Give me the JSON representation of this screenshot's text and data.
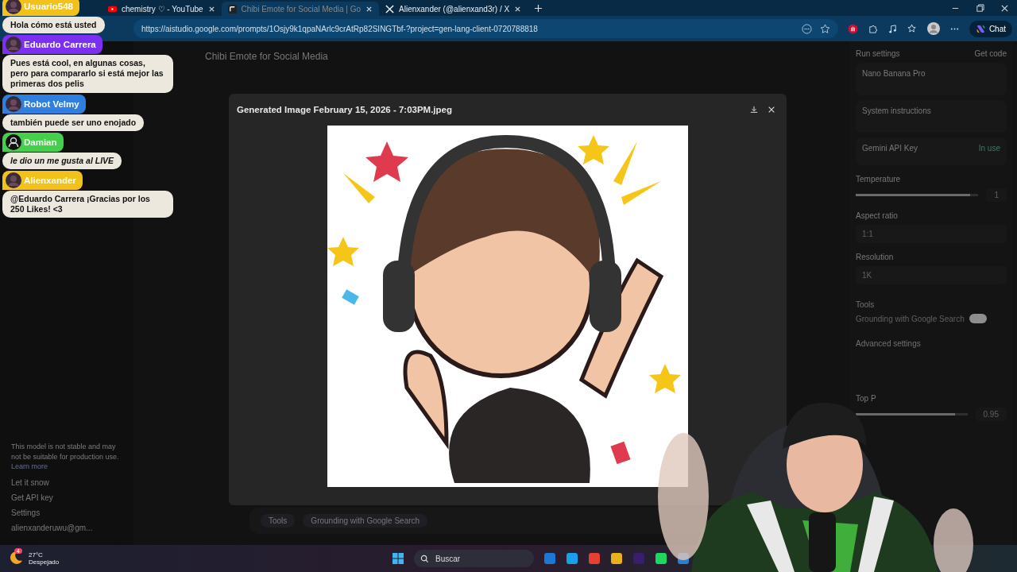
{
  "browser": {
    "tabs": [
      {
        "title": "chemistry ♡ - YouTube",
        "kind": "youtube",
        "selected": false
      },
      {
        "title": "Chibi Emote for Social Media | Go",
        "kind": "studio",
        "selected": true
      },
      {
        "title": "Alienxander (@alienxand3r) / X",
        "kind": "x",
        "selected": false
      }
    ],
    "url": "https://aistudio.google.com/prompts/1Osjy9k1qpaNArlc9crAtRp82SINGTbf-?project=gen-lang-client-0720788818",
    "chat_button": "Chat"
  },
  "app": {
    "title": "Chibi Emote for Social Media",
    "sidebar": {
      "notice": "This model is not stable and may not be suitable for production use.",
      "notice_link": "Learn more",
      "items": [
        "Let it snow",
        "Get API key",
        "Settings"
      ],
      "account": "alienxanderuwu@gm..."
    },
    "run_settings": {
      "title": "Run settings",
      "get_code": "Get code",
      "model": "Nano Banana Pro",
      "system_instructions": "System instructions",
      "api_key": "Gemini API Key",
      "api_status": "In use",
      "temperature": {
        "label": "Temperature",
        "level": 0.93,
        "value": "1"
      },
      "aspect_ratio": {
        "label": "Aspect ratio",
        "value": "1:1"
      },
      "resolution": {
        "label": "Resolution",
        "value": "1K"
      },
      "tools": "Tools",
      "grounding": {
        "label": "Grounding with Google Search",
        "on": true
      },
      "advanced": "Advanced settings",
      "top_p": {
        "label": "Top P",
        "level": 0.89,
        "value": "0.95"
      }
    },
    "composer": {
      "tools": "Tools",
      "chip": "Grounding with Google Search"
    }
  },
  "modal": {
    "title": "Generated Image February 15, 2026 - 7:03PM.jpeg"
  },
  "chat": [
    {
      "user": "Usuario548",
      "color": "#f2c21b",
      "kind": "message",
      "text": "Hola cómo está usted"
    },
    {
      "user": "Eduardo Carrera",
      "color": "#7b2ff0",
      "kind": "message",
      "text": "Pues está cool, en algunas cosas, pero para compararlo si está mejor las primeras dos pelis"
    },
    {
      "user": "Robot Velmy",
      "color": "#2f7fe0",
      "kind": "message",
      "text": "también puede ser uno enojado"
    },
    {
      "user": "Damian",
      "color": "#44d04a",
      "kind": "event",
      "text": "le dio un me gusta al LIVE"
    },
    {
      "user": "Alienxander",
      "color": "#f2c21b",
      "kind": "message",
      "text": "@Eduardo Carrera ¡Gracias por los 250 Likes! <3"
    }
  ],
  "taskbar": {
    "weather_badge": "4",
    "temperature": "27°C",
    "condition": "Despejado",
    "search_placeholder": "Buscar"
  }
}
